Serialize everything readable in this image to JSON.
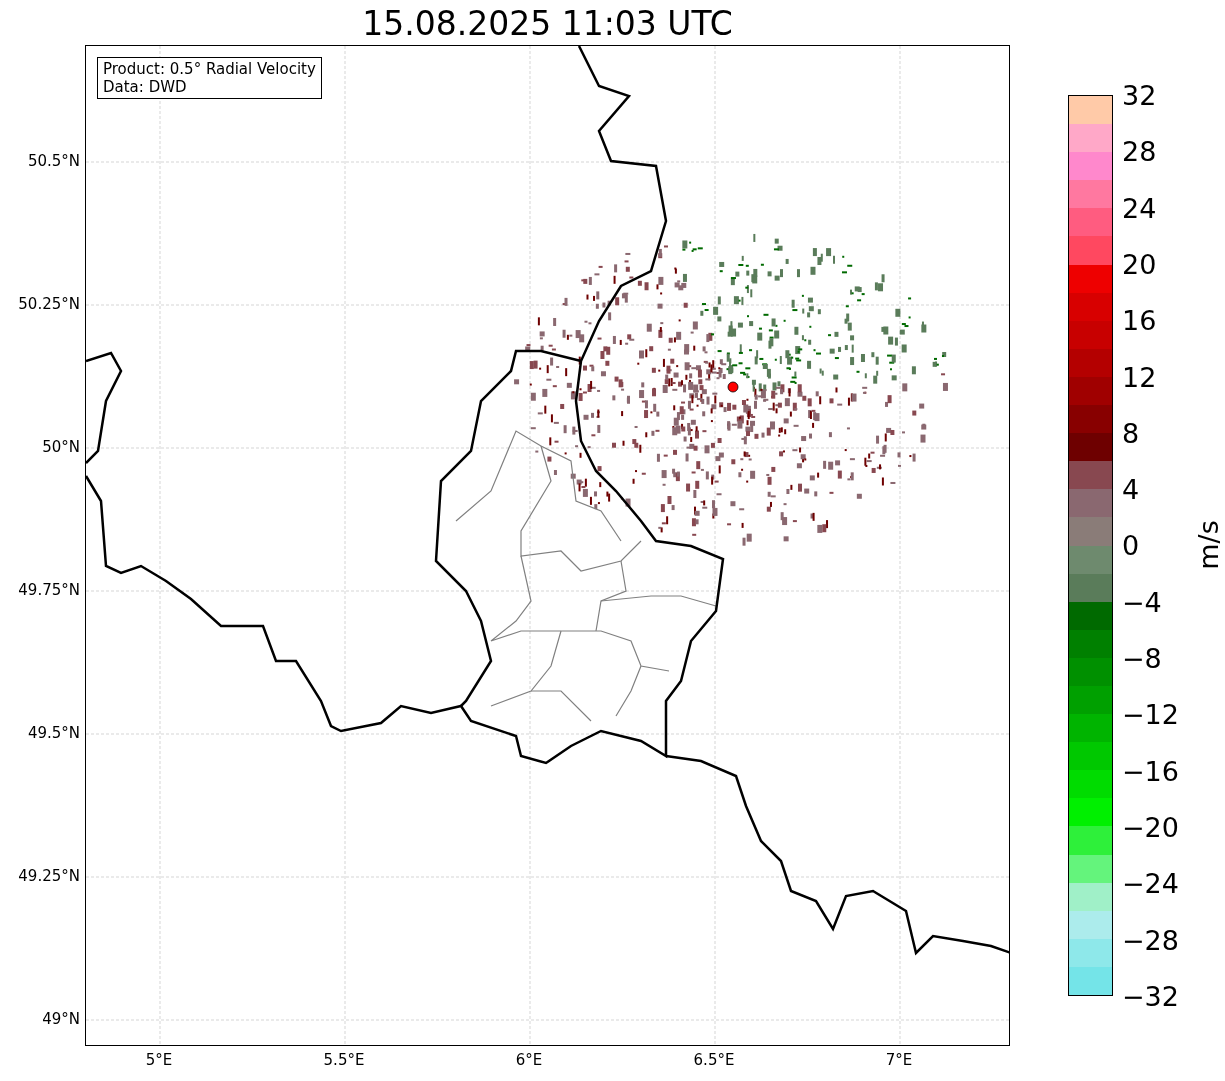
{
  "title": "15.08.2025 11:03 UTC",
  "info_box": [
    "Product: 0.5° Radial Velocity",
    "Data: DWD"
  ],
  "map": {
    "lat_ticks": [
      "50.5°N",
      "50.25°N",
      "50°N",
      "49.75°N",
      "49.5°N",
      "49.25°N",
      "49°N"
    ],
    "lon_ticks": [
      "5°E",
      "5.5°E",
      "6°E",
      "6.5°E",
      "7°E"
    ]
  },
  "colorbar": {
    "label": "m/s",
    "ticks": [
      "32",
      "28",
      "24",
      "20",
      "16",
      "12",
      "8",
      "4",
      "0",
      "−4",
      "−8",
      "−12",
      "−16",
      "−20",
      "−24",
      "−28",
      "−32"
    ],
    "bands": [
      {
        "color": "#ffcaa8"
      },
      {
        "color": "#ffa8c8"
      },
      {
        "color": "#ff88cc"
      },
      {
        "color": "#ff78a0"
      },
      {
        "color": "#ff5c80"
      },
      {
        "color": "#ff4860"
      },
      {
        "color": "#ee0000"
      },
      {
        "color": "#d80000"
      },
      {
        "color": "#c80000"
      },
      {
        "color": "#b40000"
      },
      {
        "color": "#a00000"
      },
      {
        "color": "#880000"
      },
      {
        "color": "#6e0000"
      },
      {
        "color": "#884850"
      },
      {
        "color": "#8a6870"
      },
      {
        "color": "#8a7c78"
      },
      {
        "color": "#6e8a6e"
      },
      {
        "color": "#5a7c5a"
      },
      {
        "color": "#006a00"
      },
      {
        "color": "#008000"
      },
      {
        "color": "#009000"
      },
      {
        "color": "#00a000"
      },
      {
        "color": "#00b400"
      },
      {
        "color": "#00c800"
      },
      {
        "color": "#00dc00"
      },
      {
        "color": "#00f000"
      },
      {
        "color": "#2ef03a"
      },
      {
        "color": "#64f47c"
      },
      {
        "color": "#a0f0c8"
      },
      {
        "color": "#acecec"
      },
      {
        "color": "#8ee8ea"
      },
      {
        "color": "#74e4e8"
      }
    ]
  }
}
